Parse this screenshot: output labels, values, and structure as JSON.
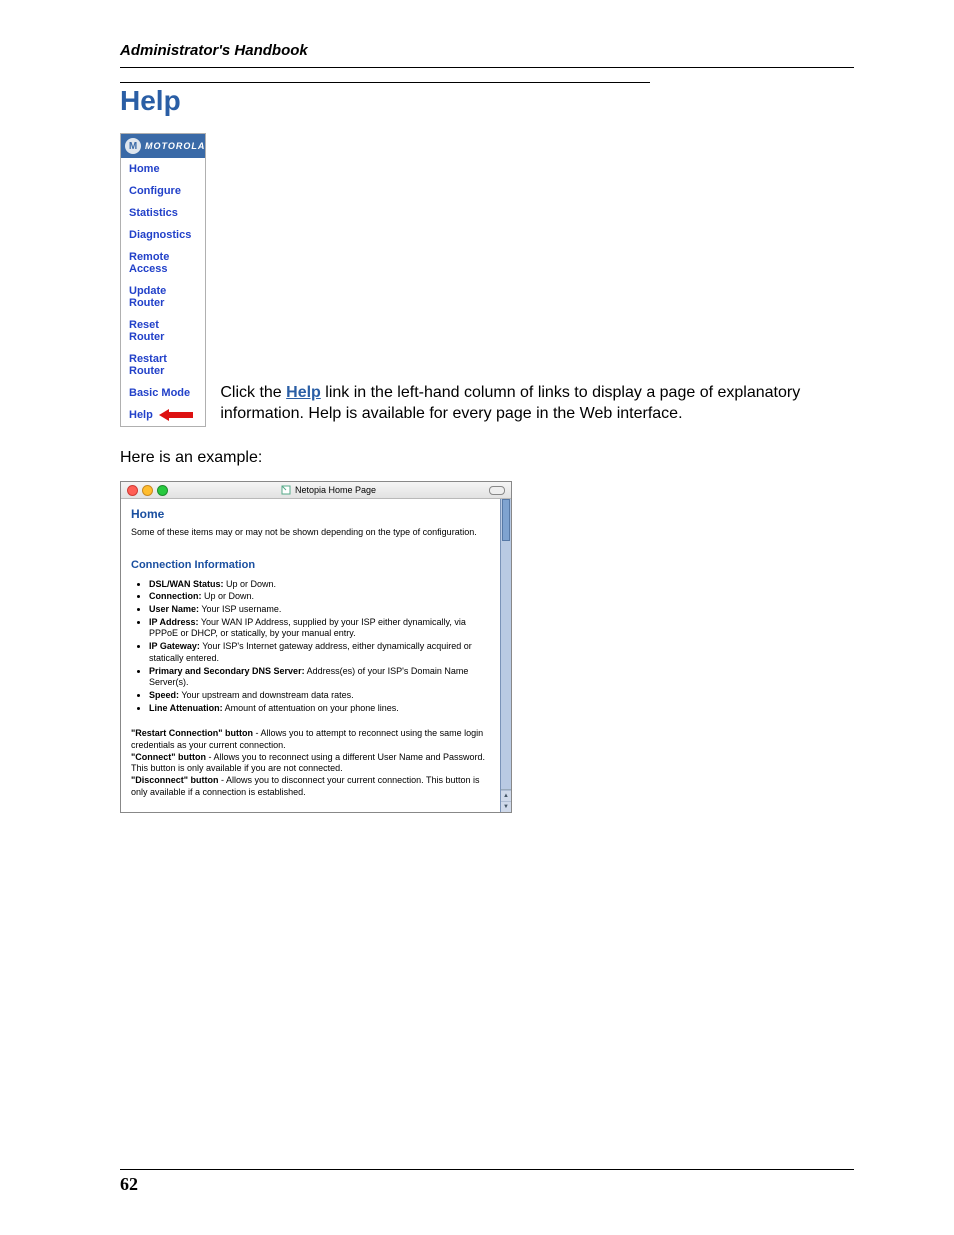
{
  "runningHead": "Administrator's Handbook",
  "sectionHeading": "Help",
  "navLogoBrand": "MOTOROLA",
  "navItems": [
    "Home",
    "Configure",
    "Statistics",
    "Diagnostics",
    "Remote Access",
    "Update Router",
    "Reset Router",
    "Restart Router",
    "Basic Mode",
    "Help"
  ],
  "sideText": {
    "pre": "Click the ",
    "link": "Help",
    "post": " link in the left-hand column of links to display a page of explanatory information. Help is available for every page in the Web interface."
  },
  "exampleLine": "Here is an example:",
  "window": {
    "title": "Netopia Home Page",
    "homeHeading": "Home",
    "intro": "Some of these items may or may not be shown depending on the type of configuration.",
    "connHeading": "Connection Information",
    "items": [
      {
        "b": "DSL/WAN Status:",
        "t": " Up or Down."
      },
      {
        "b": "Connection:",
        "t": " Up or Down."
      },
      {
        "b": "User Name:",
        "t": " Your ISP username."
      },
      {
        "b": "IP Address:",
        "t": " Your WAN IP Address, supplied by your ISP either dynamically, via PPPoE or DHCP, or statically, by your manual entry."
      },
      {
        "b": "IP Gateway:",
        "t": " Your ISP's Internet gateway address, either dynamically acquired or statically entered."
      },
      {
        "b": "Primary and Secondary DNS Server:",
        "t": " Address(es) of your ISP's Domain Name Server(s)."
      },
      {
        "b": "Speed:",
        "t": " Your upstream and downstream data rates."
      },
      {
        "b": "Line Attenuation:",
        "t": " Amount of attentuation on your phone lines."
      }
    ],
    "buttons": [
      {
        "b": "\"Restart Connection\" button",
        "t": " - Allows you to attempt to reconnect using the same login credentials as your current connection."
      },
      {
        "b": "\"Connect\" button",
        "t": " - Allows you to reconnect using a different User Name and Password. This button is only available if you are not connected."
      },
      {
        "b": "\"Disconnect\" button",
        "t": " - Allows you to disconnect your current connection. This button is only available if a connection is established."
      }
    ]
  },
  "pageNumber": "62"
}
